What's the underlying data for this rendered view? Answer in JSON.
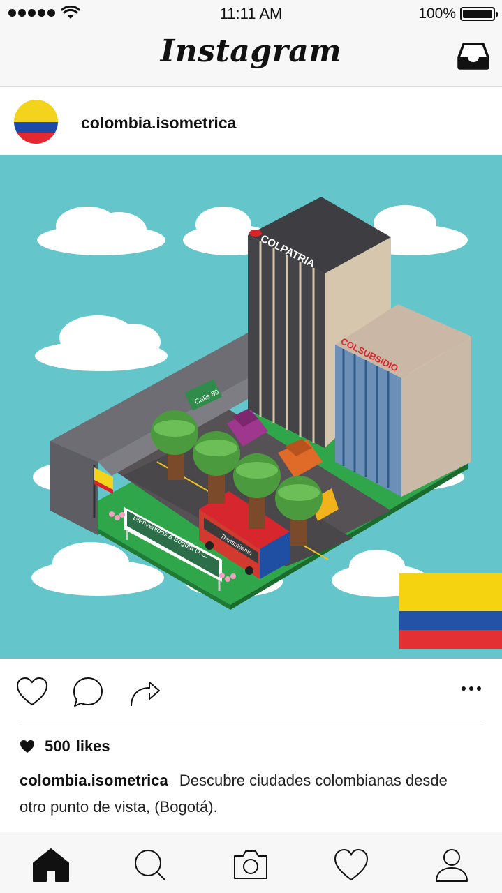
{
  "status_bar": {
    "time": "11:11 AM",
    "battery": "100%",
    "icons": [
      "signal-dots",
      "wifi-icon",
      "battery-icon"
    ]
  },
  "header": {
    "title": "Instagram",
    "inbox_icon": "inbox-tray-icon"
  },
  "post": {
    "username": "colombia.isometrica",
    "avatar": "colombia-flag-avatar",
    "image": {
      "description_icon": "isometric-bogota-illustration",
      "sign_calle": "Calle 80",
      "sign_welcome": "Bienvenidos a Bogota D.C.",
      "bus_label": "Transmilenio",
      "building_labels": [
        "COLPATRIA",
        "COLSUBSIDIO"
      ],
      "colors": {
        "sky": "#64c6ca",
        "flag_yellow": "#f6d311",
        "flag_blue": "#2352a6",
        "flag_red": "#e33032"
      }
    },
    "actions": {
      "like_icon": "heart-icon",
      "comment_icon": "comment-icon",
      "share_icon": "share-icon",
      "more_icon": "more-options-icon"
    },
    "likes": {
      "count": "500",
      "label": "likes"
    },
    "caption": {
      "username": "colombia.isometrica",
      "text": "Descubre ciudades colombianas desde otro punto de vista, (Bogotá)."
    }
  },
  "tabbar": {
    "items": [
      "home-icon",
      "search-icon",
      "camera-icon",
      "activity-heart-icon",
      "profile-icon"
    ],
    "active": "home-icon"
  }
}
